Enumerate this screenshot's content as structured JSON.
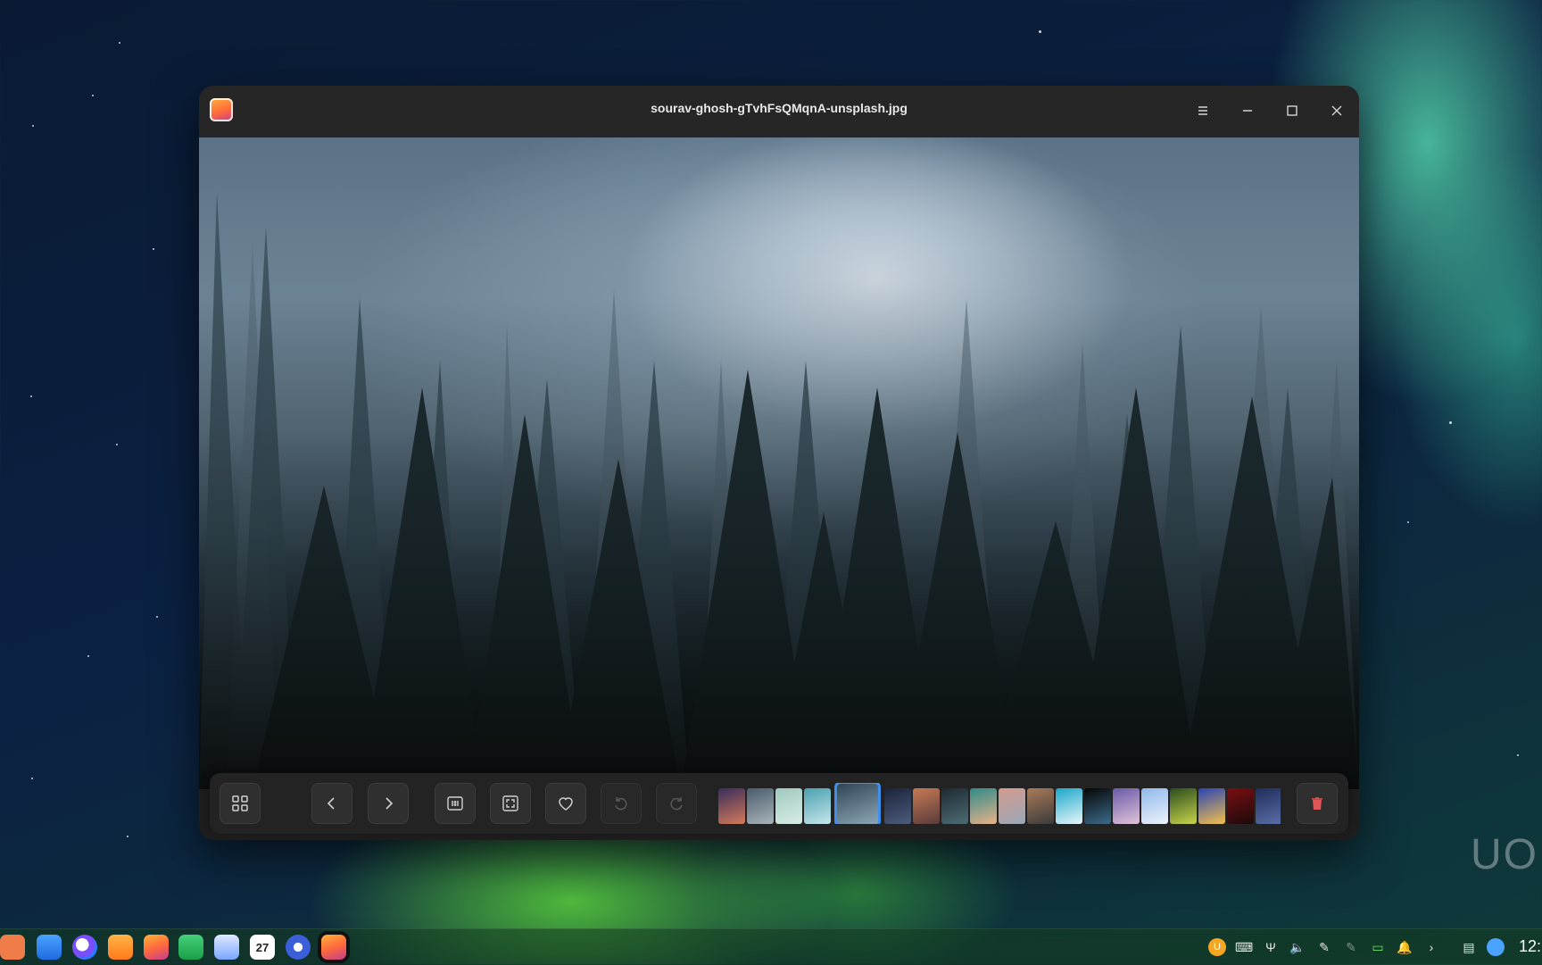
{
  "window": {
    "title": "sourav-ghosh-gTvhFsQMqnA-unsplash.jpg",
    "app_icon": "photos-app-icon",
    "controls": [
      "menu-icon",
      "minimize-icon",
      "maximize-icon",
      "close-icon"
    ]
  },
  "toolbar": {
    "buttons": [
      "gallery-grid-icon",
      "previous-icon",
      "next-icon",
      "actual-size-icon",
      "fit-window-icon",
      "favorite-icon",
      "rotate-left-icon",
      "rotate-right-icon",
      "delete-icon"
    ],
    "disabled": [
      "rotate-left-icon",
      "rotate-right-icon"
    ],
    "thumbnails": [
      {
        "colors": [
          "#3a2d5c",
          "#d27a5a"
        ]
      },
      {
        "colors": [
          "#4a5b6c",
          "#a8b4b8"
        ]
      },
      {
        "colors": [
          "#9ec9c0",
          "#d9ece6"
        ]
      },
      {
        "colors": [
          "#4aa0b0",
          "#c6e6ea"
        ]
      },
      {
        "colors": [
          "#2f4656",
          "#8ea7b7"
        ],
        "active": true
      },
      {
        "colors": [
          "#1b2439",
          "#4d5c7d"
        ]
      },
      {
        "colors": [
          "#c77a54",
          "#5a3b3b"
        ]
      },
      {
        "colors": [
          "#1e2a33",
          "#4d6c74"
        ]
      },
      {
        "colors": [
          "#2e8a88",
          "#e8b28a"
        ]
      },
      {
        "colors": [
          "#d39b8e",
          "#9aa8b8"
        ]
      },
      {
        "colors": [
          "#a97a58",
          "#3b3b3b"
        ]
      },
      {
        "colors": [
          "#19a7c9",
          "#e9f6fa"
        ]
      },
      {
        "colors": [
          "#060606",
          "#3c6b8a"
        ]
      },
      {
        "colors": [
          "#6a5aa8",
          "#e0c3d8"
        ]
      },
      {
        "colors": [
          "#8fb8ea",
          "#eef3fb"
        ]
      },
      {
        "colors": [
          "#2a4d1e",
          "#c9d34a"
        ]
      },
      {
        "colors": [
          "#2944b5",
          "#f3c04d"
        ]
      },
      {
        "colors": [
          "#7a0e12",
          "#1b0b0b"
        ]
      },
      {
        "colors": [
          "#1f2d5a",
          "#5b6ea8"
        ]
      }
    ]
  },
  "accent_color": "#3f8ef0",
  "desktop": {
    "watermark_text": "UO",
    "taskbar": {
      "apps": [
        "launcher-icon",
        "file-manager-icon",
        "browser-icon",
        "app-store-icon",
        "photos-icon",
        "music-icon",
        "documents-icon",
        "calendar-icon",
        "settings-icon",
        "image-viewer-icon"
      ],
      "calendar_day": "27",
      "tray": [
        "uos-assistant-icon",
        "keyboard-icon",
        "usb-icon",
        "volume-icon",
        "pen-icon",
        "pen-disabled-icon",
        "battery-icon",
        "notification-icon",
        "expand-tray-icon",
        "onscreen-keyboard-icon",
        "network-icon"
      ],
      "clock": "12:"
    }
  }
}
